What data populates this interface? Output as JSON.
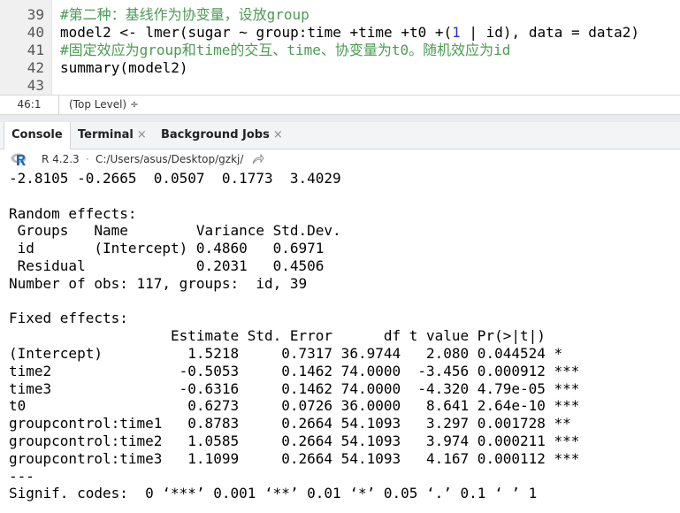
{
  "editor": {
    "lines": [
      {
        "num": "39",
        "text": "#第二种：基线作为协变量，设放group",
        "kind": "comment"
      },
      {
        "num": "40",
        "text": "model2 <- lmer(sugar ~ group:time +time +t0 +(1 | id), data = data2)",
        "kind": "code"
      },
      {
        "num": "41",
        "text": "#固定效应为group和time的交互、time、协变量为t0。随机效应为id",
        "kind": "comment"
      },
      {
        "num": "42",
        "text": "summary(model2)",
        "kind": "code"
      },
      {
        "num": "43",
        "text": "",
        "kind": "code"
      }
    ]
  },
  "status": {
    "cursor_position": "46:1",
    "scope": "(Top Level) ÷"
  },
  "tabs": [
    {
      "label": "Console",
      "closable": false
    },
    {
      "label": "Terminal",
      "closable": true
    },
    {
      "label": "Background Jobs",
      "closable": true
    }
  ],
  "close_glyph": "×",
  "pathbar": {
    "r_version": "R 4.2.3",
    "separator": "·",
    "path": "C:/Users/asus/Desktop/gzkj/"
  },
  "console": {
    "lines": [
      "-2.8105 -0.2665  0.0507  0.1773  3.4029",
      "",
      "Random effects:",
      " Groups   Name        Variance Std.Dev.",
      " id       (Intercept) 0.4860   0.6971  ",
      " Residual             0.2031   0.4506  ",
      "Number of obs: 117, groups:  id, 39",
      "",
      "Fixed effects:",
      "                   Estimate Std. Error      df t value Pr(>|t|)    ",
      "(Intercept)          1.5218     0.7317 36.9744   2.080 0.044524 *  ",
      "time2               -0.5053     0.1462 74.0000  -3.456 0.000912 ***",
      "time3               -0.6316     0.1462 74.0000  -4.320 4.79e-05 ***",
      "t0                   0.6273     0.0726 36.0000   8.641 2.64e-10 ***",
      "groupcontrol:time1   0.8783     0.2664 54.1093   3.297 0.001728 ** ",
      "groupcontrol:time2   1.0585     0.2664 54.1093   3.974 0.000211 ***",
      "groupcontrol:time3   1.1099     0.2664 54.1093   4.167 0.000112 ***",
      "---",
      "Signif. codes:  0 ‘***’ 0.001 ‘**’ 0.01 ‘*’ 0.05 ‘.’ 0.1 ‘ ’ 1"
    ]
  },
  "colors": {
    "comment": "#4b9b53",
    "number": "#2f2fd6",
    "r_logo_blue": "#2266b8"
  }
}
